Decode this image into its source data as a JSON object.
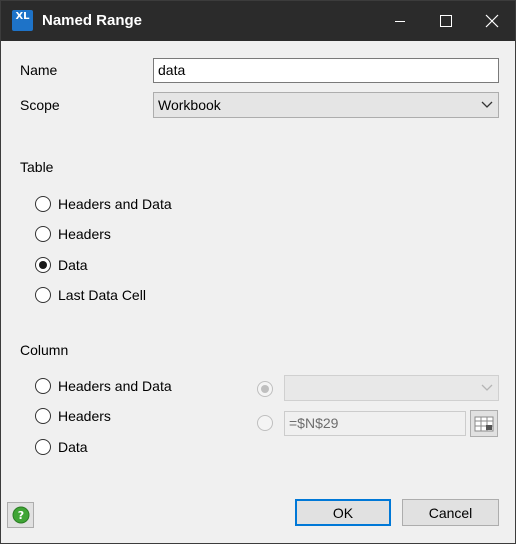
{
  "window": {
    "title": "Named Range",
    "app_icon_text": "XL",
    "app_icon_color": "#1e73c8"
  },
  "form": {
    "name_label": "Name",
    "name_value": "data",
    "scope_label": "Scope",
    "scope_value": "Workbook"
  },
  "table": {
    "header": "Table",
    "options": [
      {
        "label": "Headers and Data",
        "checked": false
      },
      {
        "label": "Headers",
        "checked": false
      },
      {
        "label": "Data",
        "checked": true
      },
      {
        "label": "Last Data Cell",
        "checked": false
      }
    ]
  },
  "column": {
    "header": "Column",
    "options": [
      {
        "label": "Headers and Data",
        "checked": false
      },
      {
        "label": "Headers",
        "checked": false
      },
      {
        "label": "Data",
        "checked": false
      }
    ],
    "column_select_value": "",
    "reference_value": "=$N$29"
  },
  "buttons": {
    "ok": "OK",
    "cancel": "Cancel"
  },
  "colors": {
    "titlebar": "#2b2b2b",
    "default_button_border": "#0078d7",
    "help_icon": "#3fa535"
  }
}
